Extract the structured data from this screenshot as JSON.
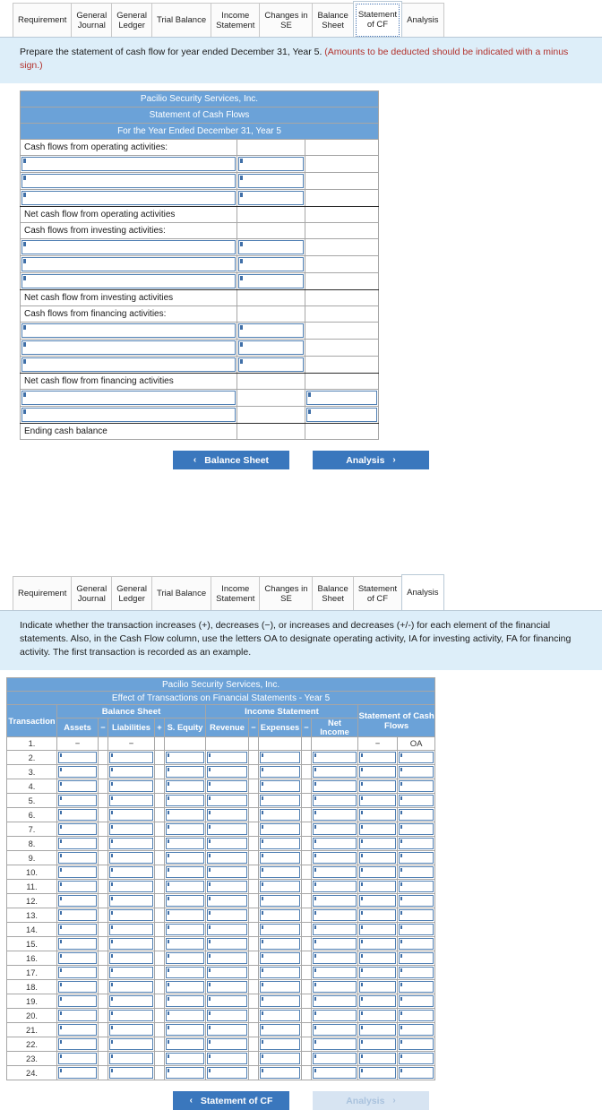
{
  "tabs": [
    {
      "label": "Requirement",
      "active": false
    },
    {
      "label": "General\nJournal",
      "active": false
    },
    {
      "label": "General\nLedger",
      "active": false
    },
    {
      "label": "Trial Balance",
      "active": false
    },
    {
      "label": "Income\nStatement",
      "active": false
    },
    {
      "label": "Changes in\nSE",
      "active": false
    },
    {
      "label": "Balance\nSheet",
      "active": false
    },
    {
      "label": "Statement\nof CF",
      "active": true
    },
    {
      "label": "Analysis",
      "active": false
    }
  ],
  "tabs_bottom": [
    {
      "label": "Requirement",
      "active": false
    },
    {
      "label": "General\nJournal",
      "active": false
    },
    {
      "label": "General\nLedger",
      "active": false
    },
    {
      "label": "Trial Balance",
      "active": false
    },
    {
      "label": "Income\nStatement",
      "active": false
    },
    {
      "label": "Changes in\nSE",
      "active": false
    },
    {
      "label": "Balance\nSheet",
      "active": false
    },
    {
      "label": "Statement\nof CF",
      "active": false
    },
    {
      "label": "Analysis",
      "active": true
    }
  ],
  "cf_panel": {
    "instruction_main": "Prepare the statement of cash flow for year ended December 31, Year 5. ",
    "instruction_warning": "(Amounts to be deducted should be indicated with a minus sign.)",
    "title_line1": "Pacilio Security Services, Inc.",
    "title_line2": "Statement of Cash Flows",
    "title_line3": "For the Year Ended December 31, Year 5",
    "rows": [
      {
        "type": "label",
        "label": "Cash flows from operating activities:"
      },
      {
        "type": "input",
        "label": "",
        "col2": true,
        "col3": false
      },
      {
        "type": "input",
        "label": "",
        "col2": true,
        "col3": false
      },
      {
        "type": "input",
        "label": "",
        "col2": true,
        "col3": false,
        "thickbot": true
      },
      {
        "type": "label",
        "label": "Net cash flow from operating activities"
      },
      {
        "type": "label",
        "label": "Cash flows from investing activities:"
      },
      {
        "type": "input",
        "label": "",
        "col2": true,
        "col3": false
      },
      {
        "type": "input",
        "label": "",
        "col2": true,
        "col3": false
      },
      {
        "type": "input",
        "label": "",
        "col2": true,
        "col3": false,
        "thickbot": true
      },
      {
        "type": "label",
        "label": "Net cash flow from investing activities"
      },
      {
        "type": "label",
        "label": "Cash flows from financing activities:"
      },
      {
        "type": "input",
        "label": "",
        "col2": true,
        "col3": false
      },
      {
        "type": "input",
        "label": "",
        "col2": true,
        "col3": false
      },
      {
        "type": "input",
        "label": "",
        "col2": true,
        "col3": false,
        "thickbot": true
      },
      {
        "type": "label",
        "label": "Net cash flow from financing activities"
      },
      {
        "type": "input",
        "label": "",
        "col2": false,
        "col3": true
      },
      {
        "type": "input",
        "label": "",
        "col2": false,
        "col3": true,
        "thickbot": true
      },
      {
        "type": "label",
        "label": "Ending cash balance"
      }
    ],
    "nav": {
      "prev_label": "Balance Sheet",
      "prev_chevron": "‹",
      "next_label": "Analysis",
      "next_chevron": "›",
      "prev_disabled": false,
      "next_disabled": false
    }
  },
  "analysis_panel": {
    "instruction": "Indicate whether the transaction increases (+), decreases (−), or increases and decreases (+/-) for each element of the financial statements. Also, in the Cash Flow column, use the letters OA to designate operating activity, IA for investing activity, FA for financing activity. The first transaction is recorded as an example.",
    "title_line1": "Pacilio Security Services, Inc.",
    "title_line2": "Effect of Transactions on Financial Statements - Year 5",
    "group_headers": [
      {
        "label": "",
        "span": 1
      },
      {
        "label": "Balance Sheet",
        "span": 5
      },
      {
        "label": "Income Statement",
        "span": 5
      },
      {
        "label": "Statement of Cash Flows",
        "span": 2
      }
    ],
    "column_headers": [
      "Transaction",
      "Assets",
      "−",
      "Liabilities",
      "+",
      "S. Equity",
      "Revenue",
      "−",
      "Expenses",
      "−",
      "Net\nIncome",
      ""
    ],
    "example_row": {
      "number": "1.",
      "assets": "−",
      "op1": "",
      "liabilities": "−",
      "op2": "",
      "s_equity": "",
      "revenue": "",
      "op3": "",
      "expenses": "",
      "op4": "",
      "net_income": "",
      "cash_amount": "−",
      "cash_activity": "OA"
    },
    "transaction_numbers": [
      "2.",
      "3.",
      "4.",
      "5.",
      "6.",
      "7.",
      "8.",
      "9.",
      "10.",
      "11.",
      "12.",
      "13.",
      "14.",
      "15.",
      "16.",
      "17.",
      "18.",
      "19.",
      "20.",
      "21.",
      "22.",
      "23.",
      "24."
    ],
    "nav": {
      "prev_label": "Statement of CF",
      "prev_chevron": "‹",
      "next_label": "Analysis",
      "next_chevron": "›",
      "prev_disabled": false,
      "next_disabled": true
    }
  },
  "colors": {
    "header_blue": "#6ba2d8",
    "banner_blue": "#ddeef9",
    "button_blue": "#3a77bd",
    "button_disabled": "#d7e4f2",
    "warning_red": "#b2312c",
    "input_border": "#4f7fb3"
  }
}
